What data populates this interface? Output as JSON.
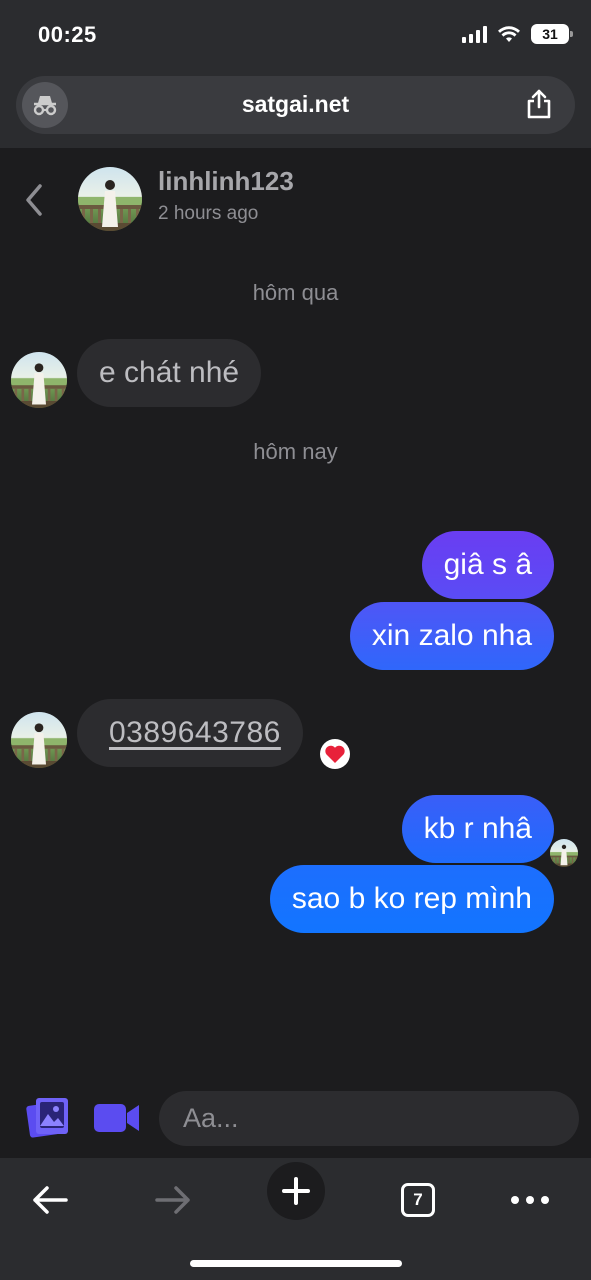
{
  "status": {
    "time": "00:25",
    "battery": "31"
  },
  "browser": {
    "url": "satgai.net",
    "tab_count": "7"
  },
  "chat": {
    "username": "linhlinh123",
    "last_seen": "2 hours ago",
    "day_labels": [
      "hôm qua",
      "hôm nay"
    ],
    "messages": [
      {
        "from": "them",
        "text": "e chát nhé"
      },
      {
        "from": "me",
        "text": "giâ s â"
      },
      {
        "from": "me",
        "text": "xin zalo nha"
      },
      {
        "from": "them",
        "text": "0389643786",
        "reaction": "heart"
      },
      {
        "from": "me",
        "text": "kb r nhâ"
      },
      {
        "from": "me",
        "text": "sao b ko rep mình"
      }
    ]
  },
  "composer": {
    "placeholder": "Aa..."
  },
  "colors": {
    "accent": "#5b4cf0",
    "bubble_gradient_top": "#6a3df2",
    "bubble_gradient_bottom": "#1275ff",
    "incoming_bubble": "#2c2c2f",
    "reaction_heart": "#e8213a"
  },
  "icons": {
    "incognito": "incognito-icon",
    "share": "share-icon",
    "back": "chevron-left-icon",
    "image": "image-gallery-icon",
    "video": "video-camera-icon",
    "toolbar": [
      "arrow-left-icon",
      "arrow-right-icon",
      "plus-icon",
      "tabs-icon",
      "more-icon"
    ]
  }
}
